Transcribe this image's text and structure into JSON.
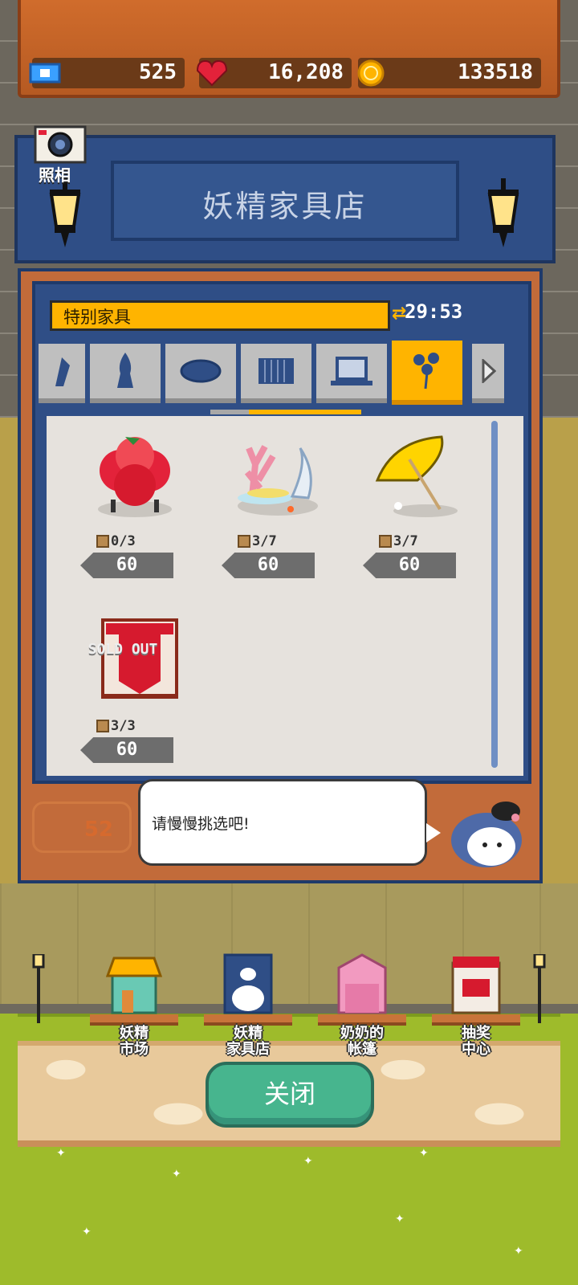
{
  "resources": {
    "tickets": "525",
    "hearts": "16,208",
    "coins": "133518"
  },
  "camera": {
    "label": "照相"
  },
  "shop": {
    "title": "妖精家具店",
    "category": "特别家具",
    "timer": "29:53",
    "level": "52",
    "speech": "请慢慢挑选吧!"
  },
  "tabs": [
    {
      "icon": "lamp-icon"
    },
    {
      "icon": "vase-icon"
    },
    {
      "icon": "rug-icon"
    },
    {
      "icon": "radiator-icon"
    },
    {
      "icon": "laptop-icon"
    },
    {
      "icon": "balloon-flower-icon",
      "active": true
    }
  ],
  "items": [
    {
      "name": "camellia-stool",
      "stock": "0/3",
      "price": "60",
      "sold_out": false
    },
    {
      "name": "coral-shell-decor",
      "stock": "3/7",
      "price": "60",
      "sold_out": false
    },
    {
      "name": "beach-umbrella",
      "stock": "3/7",
      "price": "60",
      "sold_out": false
    },
    {
      "name": "red-banner-stall",
      "stock": "3/3",
      "price": "60",
      "sold_out": true,
      "sold_label": "SOLD OUT"
    }
  ],
  "nav": [
    {
      "label1": "妖精",
      "label2": "市场"
    },
    {
      "label1": "妖精",
      "label2": "家具店"
    },
    {
      "label1": "奶奶的",
      "label2": "帐篷"
    },
    {
      "label1": "抽奖",
      "label2": "中心"
    }
  ],
  "close_label": "关闭",
  "colors": {
    "accent": "#ffb400",
    "panel": "#2f4e86",
    "button": "#47b58e"
  }
}
